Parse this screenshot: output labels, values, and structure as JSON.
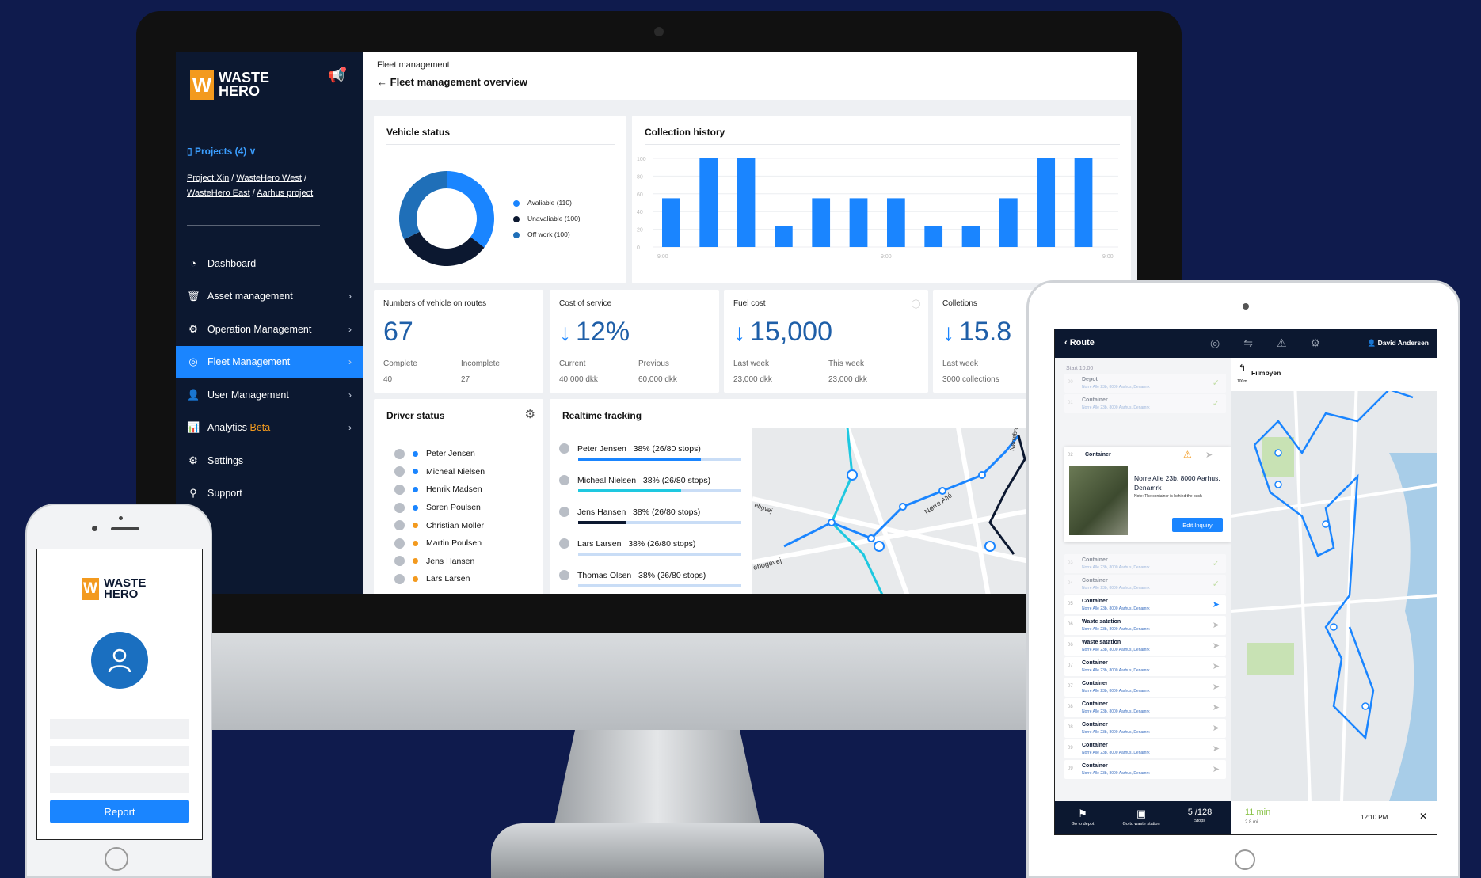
{
  "desktop": {
    "brand": {
      "mark": "W",
      "line1": "WASTE",
      "line2": "HERO"
    },
    "projects_label": "Projects (4)",
    "project_links": [
      "Project Xin",
      "WasteHero West",
      "WasteHero East",
      "Aarhus project"
    ],
    "nav": [
      {
        "label": "Dashboard",
        "icon": "dashboard-icon",
        "chevron": false,
        "active": false
      },
      {
        "label": "Asset management",
        "icon": "bin-icon",
        "chevron": true,
        "active": false
      },
      {
        "label": "Operation Management",
        "icon": "operations-icon",
        "chevron": true,
        "active": false
      },
      {
        "label": "Fleet Management",
        "icon": "compass-icon",
        "chevron": true,
        "active": true
      },
      {
        "label": "User Management",
        "icon": "users-icon",
        "chevron": true,
        "active": false
      },
      {
        "label": "Analytics",
        "badge": "Beta",
        "icon": "analytics-icon",
        "chevron": true,
        "active": false
      },
      {
        "label": "Settings",
        "icon": "gear-icon",
        "chevron": false,
        "active": false
      },
      {
        "label": "Support",
        "icon": "support-icon",
        "chevron": false,
        "active": false
      }
    ],
    "breadcrumb": "Fleet management",
    "page_title": "Fleet management overview",
    "vehicle_status": {
      "title": "Vehicle status",
      "legend": [
        {
          "label": "Avaliable (110)",
          "color": "#1a85ff"
        },
        {
          "label": "Unavaliable (100)",
          "color": "#0c1830"
        },
        {
          "label": "Off work (100)",
          "color": "#1f6fb8"
        }
      ]
    },
    "collection_history": {
      "title": "Collection history"
    },
    "kpis": [
      {
        "label": "Numbers of vehicle on routes",
        "value": "67",
        "arrow": false,
        "sub1_label": "Complete",
        "sub1_value": "40",
        "sub2_label": "Incomplete",
        "sub2_value": "27"
      },
      {
        "label": "Cost of service",
        "value": "12%",
        "arrow": true,
        "sub1_label": "Current",
        "sub1_value": "40,000 dkk",
        "sub2_label": "Previous",
        "sub2_value": "60,000 dkk"
      },
      {
        "label": "Fuel cost",
        "value": "15,000",
        "arrow": true,
        "sub1_label": "Last week",
        "sub1_value": "23,000 dkk",
        "sub2_label": "This week",
        "sub2_value": "23,000 dkk"
      },
      {
        "label": "Colletions",
        "value": "15.8",
        "arrow": true,
        "sub1_label": "Last week",
        "sub1_value": "3000 collections"
      }
    ],
    "driver_status": {
      "title": "Driver status",
      "drivers": [
        {
          "name": "Peter Jensen",
          "color": "#1a85ff"
        },
        {
          "name": "Micheal Nielsen",
          "color": "#1a85ff"
        },
        {
          "name": "Henrik Madsen",
          "color": "#1a85ff"
        },
        {
          "name": "Soren Poulsen",
          "color": "#1a85ff"
        },
        {
          "name": "Christian Moller",
          "color": "#f39a1e"
        },
        {
          "name": "Martin Poulsen",
          "color": "#f39a1e"
        },
        {
          "name": "Jens Hansen",
          "color": "#f39a1e"
        },
        {
          "name": "Lars Larsen",
          "color": "#f39a1e"
        }
      ]
    },
    "realtime_tracking": {
      "title": "Realtime tracking",
      "rows": [
        {
          "text": "Peter Jensen   38% (26/80 stops)",
          "progress": 0.75,
          "color": "#1a85ff"
        },
        {
          "text": "Micheal Nielsen   38% (26/80 stops)",
          "progress": 0.63,
          "color": "#1ec8e0"
        },
        {
          "text": "Jens Hansen   38% (26/80 stops)",
          "progress": 0.29,
          "color": "#0c1830"
        },
        {
          "text": "Lars Larsen   38% (26/80 stops)",
          "progress": 0.0,
          "color": "#1a85ff"
        },
        {
          "text": "Thomas Olsen   38% (26/80 stops)",
          "progress": 0.0,
          "color": "#1a85ff"
        }
      ],
      "map_labels": [
        "Nørre Allé",
        "Nørrebrogade",
        "ebogevej",
        "ebgvej"
      ]
    }
  },
  "phone": {
    "brand": {
      "mark": "W",
      "line1": "WASTE",
      "line2": "HERO"
    },
    "button_label": "Report"
  },
  "tablet": {
    "title": "Route",
    "user": "David Andersen",
    "start_label": "Start 10:00",
    "stops": [
      {
        "num": "00",
        "title": "Depot",
        "sub": "Norre Alle 23b, 8000 Aarhus, Denamrk",
        "state": "done"
      },
      {
        "num": "01",
        "title": "Container",
        "sub": "Norre Alle 23b, 8000 Aarhus, Denamrk",
        "state": "done"
      },
      {
        "num": "03",
        "title": "Container",
        "sub": "Norre Alle 23b, 8000 Aarhus, Denamrk",
        "state": "done"
      },
      {
        "num": "04",
        "title": "Container",
        "sub": "Norre Alle 23b, 8000 Aarhus, Denamrk",
        "state": "done"
      },
      {
        "num": "05",
        "title": "Container",
        "sub": "Norre Alle 23b, 8000 Aarhus, Denamrk",
        "state": "current"
      },
      {
        "num": "06",
        "title": "Waste satation",
        "sub": "Norre Alle 23b, 8000 Aarhus, Denamrk",
        "state": "todo"
      },
      {
        "num": "06",
        "title": "Waste satation",
        "sub": "Norre Alle 23b, 8000 Aarhus, Denamrk",
        "state": "todo"
      },
      {
        "num": "07",
        "title": "Container",
        "sub": "Norre Alle 23b, 8000 Aarhus, Denamrk",
        "state": "todo"
      },
      {
        "num": "07",
        "title": "Container",
        "sub": "Norre Alle 23b, 8000 Aarhus, Denamrk",
        "state": "todo"
      },
      {
        "num": "08",
        "title": "Container",
        "sub": "Norre Alle 23b, 8000 Aarhus, Denamrk",
        "state": "todo"
      },
      {
        "num": "08",
        "title": "Container",
        "sub": "Norre Alle 23b, 8000 Aarhus, Denamrk",
        "state": "todo"
      },
      {
        "num": "09",
        "title": "Container",
        "sub": "Norre Alle 23b, 8000 Aarhus, Denamrk",
        "state": "todo"
      },
      {
        "num": "09",
        "title": "Container",
        "sub": "Norre Alle 23b, 8000 Aarhus, Denamrk",
        "state": "todo"
      }
    ],
    "expanded_stop": {
      "num": "02",
      "title": "Container",
      "address": "Norre Alle 23b, 8000 Aarhus, Denamrk",
      "note": "Note: The container is behind the bush",
      "button": "Edit Inquiry"
    },
    "map_header": {
      "name": "Filmbyen",
      "distance": "100m"
    },
    "bottom": {
      "go_depot": "Go to depot",
      "go_station": "Go to waste station",
      "stops_count": "5 /128",
      "stops_label": "Stops",
      "eta": "11 min",
      "eta_sub": "2.8 mi",
      "time": "12:10 PM",
      "close": "✕"
    }
  },
  "chart_data": [
    {
      "type": "pie",
      "title": "Vehicle status",
      "labels": [
        "Avaliable",
        "Unavaliable",
        "Off work"
      ],
      "values": [
        110,
        100,
        100
      ],
      "donut": true
    },
    {
      "type": "bar",
      "title": "Collection history",
      "x_tick_labels": [
        "9:00",
        "9:00",
        "9:00"
      ],
      "y_ticks": [
        0,
        20,
        40,
        60,
        80,
        100
      ],
      "ylim": [
        0,
        100
      ],
      "values": [
        55,
        100,
        100,
        24,
        55,
        55,
        55,
        24,
        24,
        55,
        100,
        100
      ],
      "color": "#1a85ff",
      "grid": true
    }
  ]
}
